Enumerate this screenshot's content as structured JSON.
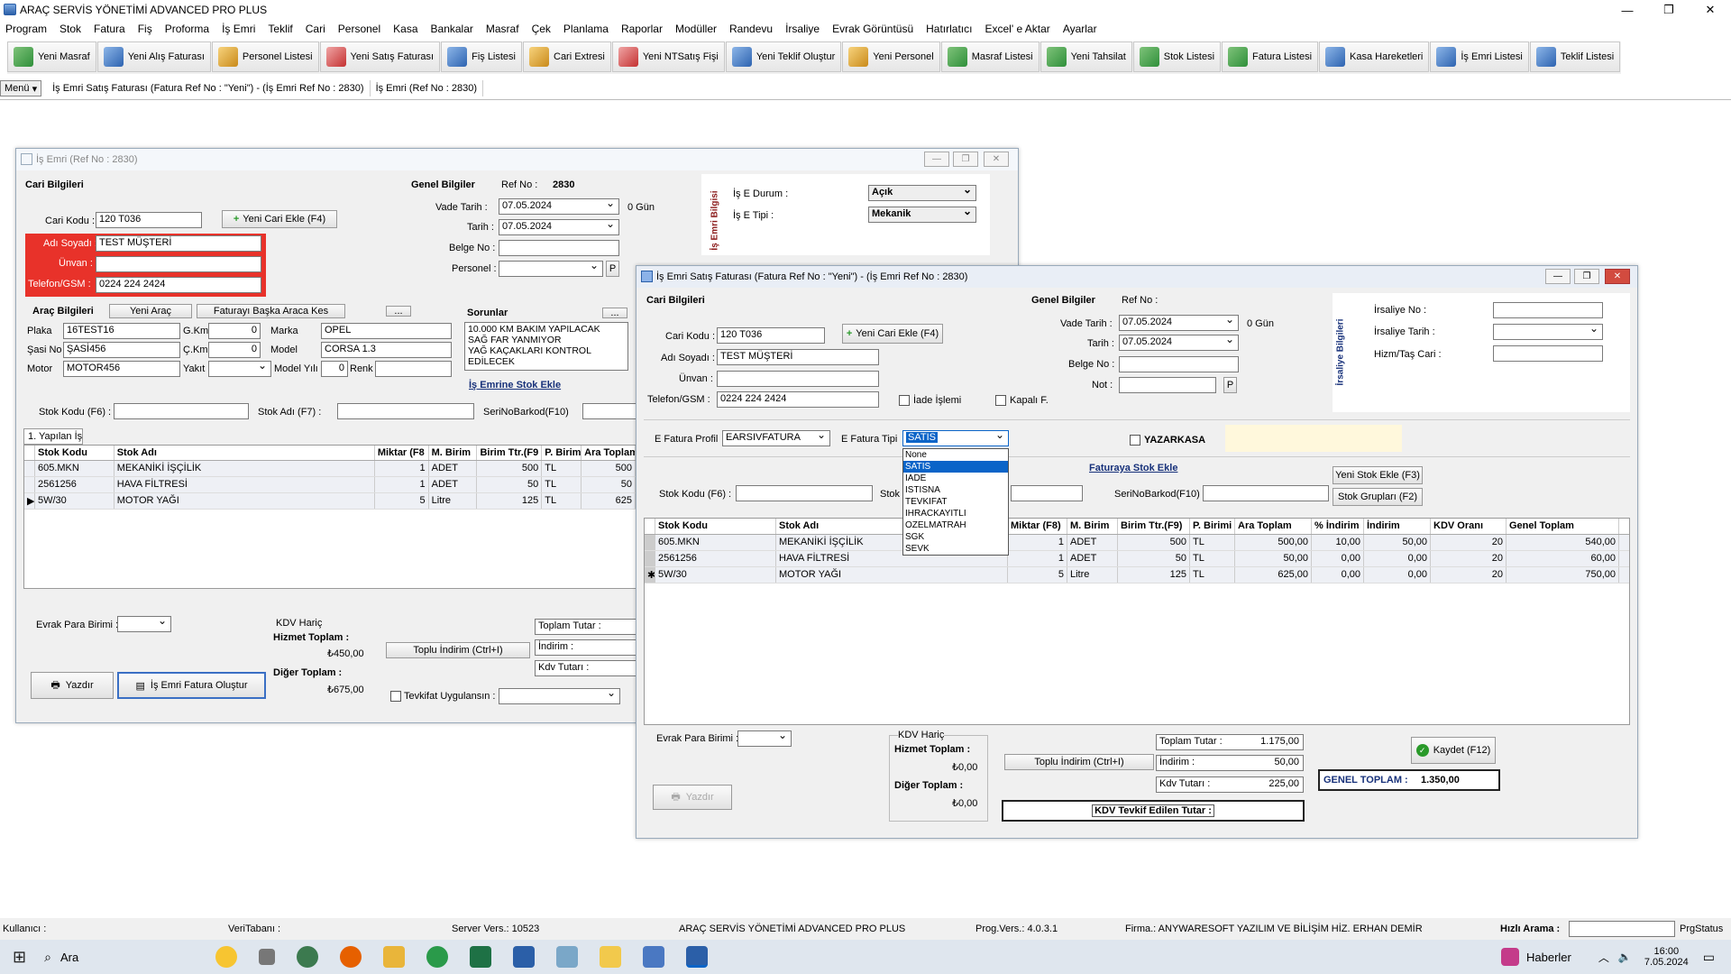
{
  "app": {
    "title": "ARAÇ SERVİS YÖNETİMİ ADVANCED PRO PLUS",
    "minimize": "—",
    "maximize": "❐",
    "close": "✕"
  },
  "menu": [
    "Program",
    "Stok",
    "Fatura",
    "Fiş",
    "Proforma",
    "İş Emri",
    "Teklif",
    "Cari",
    "Personel",
    "Kasa",
    "Bankalar",
    "Masraf",
    "Çek",
    "Planlama",
    "Raporlar",
    "Modüller",
    "Randevu",
    "İrsaliye",
    "Evrak Görüntüsü",
    "Hatırlatıcı",
    "Excel' e Aktar",
    "Ayarlar"
  ],
  "toolbar": [
    "Yeni Masraf",
    "Yeni Alış Faturası",
    "Personel Listesi",
    "Yeni Satış Faturası",
    "Fiş Listesi",
    "Cari Extresi",
    "Yeni NTSatış Fişi",
    "Yeni Teklif Oluştur",
    "Yeni Personel",
    "Masraf Listesi",
    "Yeni Tahsilat",
    "Stok Listesi",
    "Fatura Listesi",
    "Kasa Hareketleri",
    "İş Emri Listesi",
    "Teklif Listesi"
  ],
  "tabs": {
    "menu": "Menü",
    "t1": "İş Emri Satış Faturası (Fatura Ref No : \"Yeni\") - (İş Emri Ref No : 2830)",
    "t2": "İş Emri (Ref No : 2830)"
  },
  "w1": {
    "title": "İş Emri (Ref No : 2830)",
    "cari_title": "Cari Bilgileri",
    "cari_kodu_l": "Cari Kodu :",
    "cari_kodu": "120 T036",
    "yeni_cari": "Yeni Cari Ekle (F4)",
    "adi_l": "Adı Soyadı :",
    "adi": "TEST MÜŞTERİ",
    "unvan_l": "Ünvan :",
    "tel_l": "Telefon/GSM :",
    "tel": "0224 224 2424",
    "genel_title": "Genel Bilgiler",
    "ref_l": "Ref No :",
    "ref": "2830",
    "vade_l": "Vade Tarih :",
    "vade": "07.05.2024",
    "gun": "0 Gün",
    "tarih_l": "Tarih :",
    "tarih": "07.05.2024",
    "belge_l": "Belge No :",
    "personel_l": "Personel :",
    "p": "P",
    "ise_side": "İş Emri Bilgisi",
    "durum_l": "İş E Durum :",
    "durum": "Açık",
    "tip_l": "İş E Tipi :",
    "tip": "Mekanik",
    "arac_title": "Araç Bilgileri",
    "yeni_arac": "Yeni Araç",
    "baska": "Faturayı Başka Araca Kes",
    "dots": "...",
    "plaka_l": "Plaka",
    "plaka": "16TEST16",
    "gkm_l": "G.Km",
    "gkm": "0",
    "marka_l": "Marka",
    "marka": "OPEL",
    "sasi_l": "Şasi No",
    "sasi": "ŞASİ456",
    "ckm_l": "Ç.Km",
    "ckm": "0",
    "model_l": "Model",
    "model": "CORSA 1.3",
    "motor_l": "Motor",
    "motor": "MOTOR456",
    "yakit_l": "Yakıt",
    "modelyil_l": "Model Yılı",
    "modelyil": "0",
    "renk_l": "Renk",
    "sorunlar_l": "Sorunlar",
    "sorunlar": [
      "10.000 KM BAKIM YAPILACAK",
      "SAĞ FAR YANMIYOR",
      "YAĞ KAÇAKLARI KONTROL",
      "EDİLECEK"
    ],
    "stok_ekle": "İş Emrine Stok Ekle",
    "stok_kodu_l": "Stok Kodu (F6) :",
    "stok_adi_l": "Stok Adı (F7) :",
    "seri_l": "SeriNoBarkod(F10)",
    "yapilan": "1. Yapılan İş",
    "cols": [
      "Stok Kodu",
      "Stok Adı",
      "Miktar (F8",
      "M. Birim",
      "Birim Ttr.(F9",
      "P. Birim",
      "Ara Toplam"
    ],
    "rows": [
      [
        "605.MKN",
        "MEKANİKİ İŞÇİLİK",
        "1",
        "ADET",
        "500",
        "TL",
        "500"
      ],
      [
        "2561256",
        "HAVA FİLTRESİ",
        "1",
        "ADET",
        "50",
        "TL",
        "50"
      ],
      [
        "5W/30",
        "MOTOR YAĞI",
        "5",
        "Litre",
        "125",
        "TL",
        "625"
      ]
    ],
    "evrak_l": "Evrak Para Birimi :",
    "kdv_haric": "KDV Hariç",
    "hizmet_l": "Hizmet Toplam :",
    "hizmet": "₺450,00",
    "diger_l": "Diğer Toplam :",
    "diger": "₺675,00",
    "toplu": "Toplu İndirim (Ctrl+I)",
    "toplam_tutar_l": "Toplam Tutar :",
    "indirim_l": "İndirim :",
    "kdv_tutar_l": "Kdv Tutarı :",
    "yazdir": "Yazdır",
    "fatura_olustur": "İş Emri Fatura Oluştur",
    "tevkifat": "Tevkifat Uygulansın :"
  },
  "w2": {
    "title": "İş Emri Satış Faturası (Fatura Ref No : \"Yeni\") - (İş Emri Ref No : 2830)",
    "cari_title": "Cari Bilgileri",
    "cari_kodu_l": "Cari Kodu :",
    "cari_kodu": "120 T036",
    "yeni_cari": "Yeni Cari Ekle (F4)",
    "adi_l": "Adı Soyadı :",
    "adi": "TEST MÜŞTERİ",
    "unvan_l": "Ünvan :",
    "tel_l": "Telefon/GSM :",
    "tel": "0224 224 2424",
    "iade": "İade İşlemi",
    "kapali": "Kapalı F.",
    "genel_title": "Genel Bilgiler",
    "ref_l": "Ref No :",
    "vade_l": "Vade Tarih :",
    "vade": "07.05.2024",
    "gun": "0 Gün",
    "tarih_l": "Tarih :",
    "tarih": "07.05.2024",
    "belge_l": "Belge No :",
    "not_l": "Not :",
    "p": "P",
    "irs_side": "İrsaliye Bilgileri",
    "irs_no_l": "İrsaliye No :",
    "irs_tarih_l": "İrsaliye Tarih :",
    "hizm_l": "Hizm/Taş Cari :",
    "efp_l": "E Fatura Profil",
    "efp": "EARSIVFATURA",
    "eft_l": "E Fatura Tipi",
    "eft": "SATIS",
    "yazarkasa": "YAZARKASA",
    "dd_opts": [
      "None",
      "SATIS",
      "IADE",
      "ISTISNA",
      "TEVKIFAT",
      "IHRACKAYITLI",
      "OZELMATRAH",
      "SGK",
      "SEVK"
    ],
    "stok_ekle": "Faturaya Stok Ekle",
    "stok_kodu_l": "Stok Kodu (F6) :",
    "stok_l": "Stok",
    "seri_l": "SeriNoBarkod(F10)",
    "yeni_stok": "Yeni Stok Ekle (F3)",
    "stok_gruplari": "Stok Grupları (F2)",
    "cols": [
      "Stok Kodu",
      "Stok Adı",
      "Miktar (F8)",
      "M. Birim",
      "Birim Ttr.(F9)",
      "P. Birimi",
      "Ara Toplam",
      "% İndirim",
      "İndirim",
      "KDV Oranı",
      "Genel Toplam"
    ],
    "rows": [
      [
        "605.MKN",
        "MEKANİKİ İŞÇİLİK",
        "1",
        "ADET",
        "500",
        "TL",
        "500,00",
        "10,00",
        "50,00",
        "20",
        "540,00"
      ],
      [
        "2561256",
        "HAVA FİLTRESİ",
        "1",
        "ADET",
        "50",
        "TL",
        "50,00",
        "0,00",
        "0,00",
        "20",
        "60,00"
      ],
      [
        "5W/30",
        "MOTOR YAĞI",
        "5",
        "Litre",
        "125",
        "TL",
        "625,00",
        "0,00",
        "0,00",
        "20",
        "750,00"
      ]
    ],
    "evrak_l": "Evrak Para Birimi :",
    "kdv_haric": "KDV Hariç",
    "hizmet_l": "Hizmet Toplam :",
    "hizmet": "₺0,00",
    "diger_l": "Diğer Toplam :",
    "diger": "₺0,00",
    "toplu": "Toplu İndirim (Ctrl+I)",
    "toplam_tutar_l": "Toplam Tutar :",
    "toplam_tutar": "1.175,00",
    "indirim_l": "İndirim :",
    "indirim": "50,00",
    "kdv_tutar_l": "Kdv Tutarı :",
    "kdv_tutar": "225,00",
    "kaydet": "Kaydet (F12)",
    "genel_toplam_l": "GENEL TOPLAM :",
    "genel_toplam": "1.350,00",
    "tevkif": "KDV Tevkif Edilen Tutar :",
    "yazdir": "Yazdır"
  },
  "status": {
    "kullanici": "Kullanıcı :",
    "veritabani": "VeriTabanı :",
    "server": "Server Vers.: 10523",
    "app": "ARAÇ SERVİS YÖNETİMİ ADVANCED PRO PLUS",
    "prog": "Prog.Vers.: 4.0.3.1",
    "firma": "Firma.: ANYWARESOFT YAZILIM VE BİLİŞİM HİZ. ERHAN DEMİR",
    "hizli": "Hızlı Arama :",
    "prgstatus": "PrgStatus"
  },
  "taskbar": {
    "search": "Ara",
    "news": "Haberler",
    "time": "16:00",
    "date": "7.05.2024"
  }
}
